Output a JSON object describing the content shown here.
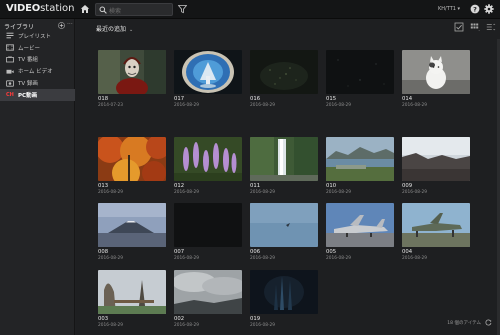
{
  "app": {
    "logo_bold": "VIDEO",
    "logo_light": "station",
    "search_placeholder": "検索",
    "user": "KH/TT1 ▾"
  },
  "sidebar": {
    "header": "ライブラリ",
    "items": [
      {
        "label": "プレイリスト",
        "icon": "playlist-icon"
      },
      {
        "label": "ムービー",
        "icon": "movie-icon"
      },
      {
        "label": "TV 番組",
        "icon": "tv-icon"
      },
      {
        "label": "ホーム ビデオ",
        "icon": "home-video-icon"
      },
      {
        "label": "TV 録画",
        "icon": "tv-recording-icon"
      },
      {
        "label": "PC動画",
        "icon": "ch-icon",
        "prefix": "CH",
        "active": true
      }
    ]
  },
  "main": {
    "section_title": "最近の追加",
    "tiles": [
      {
        "num": "018",
        "date": "2014-07-23"
      },
      {
        "num": "017",
        "date": "2016-08-29"
      },
      {
        "num": "016",
        "date": "2016-08-29"
      },
      {
        "num": "015",
        "date": "2016-08-29"
      },
      {
        "num": "014",
        "date": "2016-08-29"
      },
      {
        "num": "013",
        "date": "2016-08-29"
      },
      {
        "num": "012",
        "date": "2016-08-29"
      },
      {
        "num": "011",
        "date": "2016-08-29"
      },
      {
        "num": "010",
        "date": "2016-08-29"
      },
      {
        "num": "009",
        "date": "2016-08-29"
      },
      {
        "num": "008",
        "date": "2016-08-29"
      },
      {
        "num": "007",
        "date": "2016-08-29"
      },
      {
        "num": "006",
        "date": "2016-08-29"
      },
      {
        "num": "005",
        "date": "2016-08-29"
      },
      {
        "num": "004",
        "date": "2016-08-29"
      },
      {
        "num": "003",
        "date": "2016-08-29"
      },
      {
        "num": "002",
        "date": "2016-08-29"
      },
      {
        "num": "019",
        "date": "2016-08-29"
      }
    ],
    "footer": "18 個のアイテム"
  }
}
